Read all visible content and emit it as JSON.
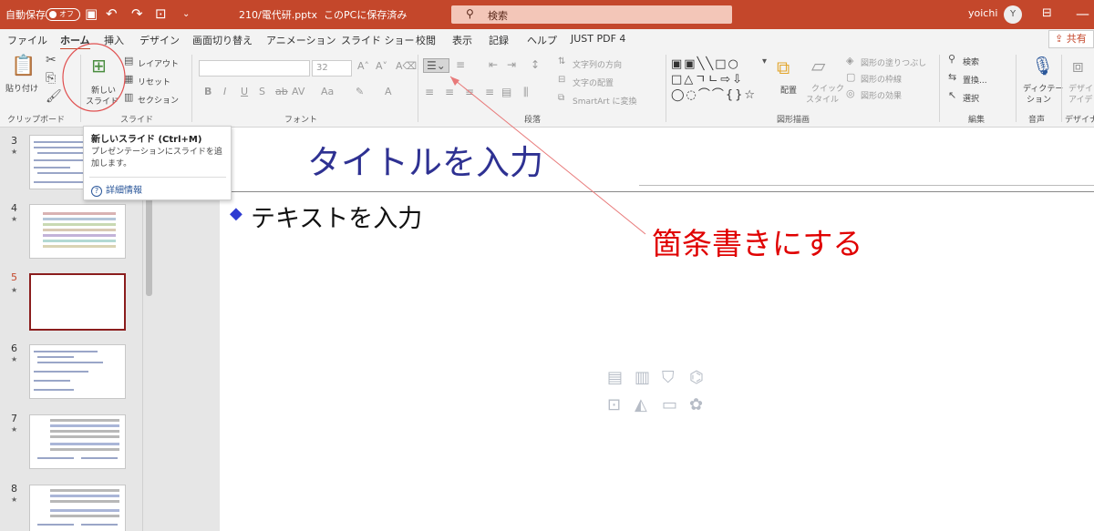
{
  "titlebar": {
    "autosave_label": "自動保存",
    "autosave_state": "オフ",
    "filename": "210/電代研.pptx",
    "save_status": "このPCに保存済み",
    "search_placeholder": "検索",
    "username": "yoichi",
    "avatar_initial": "Y"
  },
  "tabs": [
    "ファイル",
    "ホーム",
    "挿入",
    "デザイン",
    "画面切り替え",
    "アニメーション",
    "スライド ショー",
    "校閲",
    "表示",
    "記録",
    "ヘルプ",
    "JUST PDF 4"
  ],
  "share_label": "共有",
  "ribbon": {
    "clipboard": {
      "paste_label": "貼り付け",
      "group": "クリップボード"
    },
    "slides": {
      "new_slide_line1": "新しい",
      "new_slide_line2": "スライド",
      "layout": "レイアウト",
      "reset": "リセット",
      "section": "セクション",
      "group": "スライド"
    },
    "font": {
      "size": "32",
      "group": "フォント"
    },
    "paragraph": {
      "text_direction": "文字列の方向",
      "align_text": "文字の配置",
      "smartart": "SmartArt に変換",
      "group": "段落"
    },
    "drawing": {
      "arrange": "配置",
      "quick_styles_1": "クイック",
      "quick_styles_2": "スタイル",
      "fill": "図形の塗りつぶし",
      "outline": "図形の枠線",
      "effects": "図形の効果",
      "group": "図形描画"
    },
    "editing": {
      "find": "検索",
      "replace": "置換...",
      "select": "選択",
      "group": "編集"
    },
    "voice": {
      "dictate_1": "ディクテー",
      "dictate_2": "ション",
      "group": "音声"
    },
    "designer": {
      "line1": "デザイ",
      "line2": "アイデ",
      "group": "デザイナ"
    }
  },
  "tooltip": {
    "title": "新しいスライド (Ctrl+M)",
    "description": "プレゼンテーションにスライドを追加します。",
    "help_link": "詳細情報"
  },
  "thumbnails": [
    {
      "number": "3",
      "star": "★"
    },
    {
      "number": "4",
      "star": "★"
    },
    {
      "number": "5",
      "star": "★"
    },
    {
      "number": "6",
      "star": "★"
    },
    {
      "number": "7",
      "star": "★"
    },
    {
      "number": "8",
      "star": "★"
    }
  ],
  "slide": {
    "title": "タイトルを入力",
    "body_text": "テキストを入力",
    "annotation": "箇条書きにする"
  },
  "colors": {
    "accent": "#c4472b",
    "title_blue": "#2e3192",
    "annotation_red": "#e00000"
  }
}
